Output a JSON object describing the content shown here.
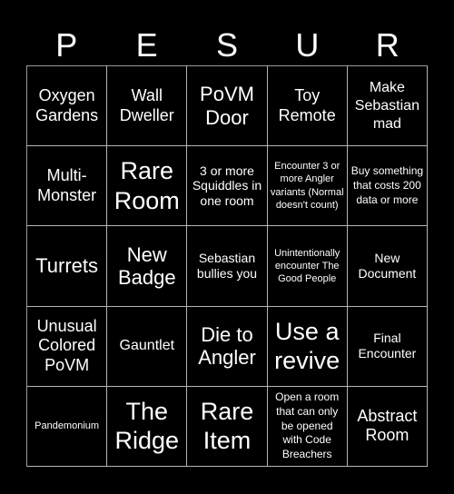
{
  "header": {
    "letters": [
      "P",
      "E",
      "S",
      "U",
      "R"
    ]
  },
  "board": {
    "rows": [
      [
        "Oxygen Gardens",
        "Wall Dweller",
        "PoVM Door",
        "Toy Remote",
        "Make Sebastian mad"
      ],
      [
        "Multi-Monster",
        "Rare Room",
        "3 or more Squiddles in one room",
        "Encounter 3 or more Angler variants (Normal doesn't count)",
        "Buy something that costs 200 data or more"
      ],
      [
        "Turrets",
        "New Badge",
        "Sebastian bullies you",
        "Unintentionally encounter The Good People",
        "New Document"
      ],
      [
        "Unusual Colored PoVM",
        "Gauntlet",
        "Die to Angler",
        "Use a revive",
        "Final Encounter"
      ],
      [
        "Pandemonium",
        "The Ridge",
        "Rare Item",
        "Open a room that can only be opened with Code Breachers",
        "Abstract Room"
      ]
    ]
  },
  "colors": {
    "background": "#000000",
    "text": "#ffffff",
    "grid_line": "#b5b5b5"
  }
}
